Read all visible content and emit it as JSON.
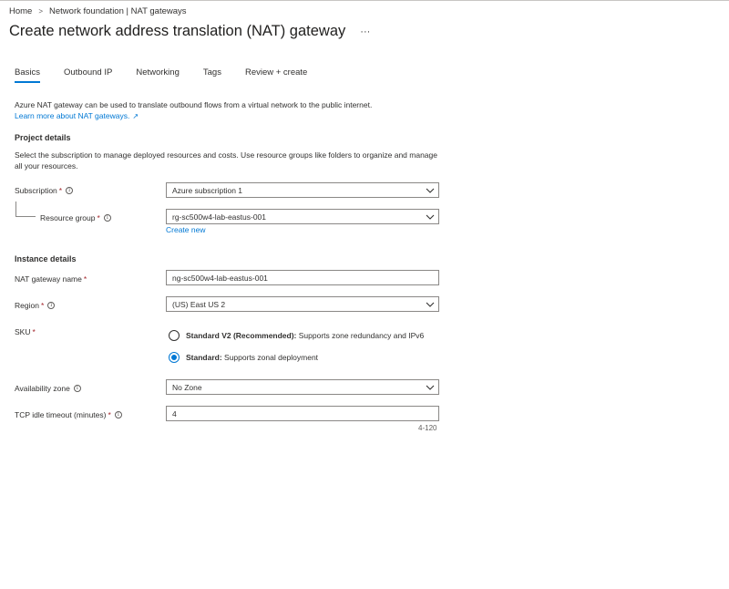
{
  "breadcrumb": {
    "items": [
      "Home",
      "Network foundation | NAT gateways"
    ],
    "separator": ">"
  },
  "header": {
    "title": "Create network address translation (NAT) gateway",
    "more_label": "···"
  },
  "tabs": [
    {
      "label": "Basics",
      "active": true
    },
    {
      "label": "Outbound IP",
      "active": false
    },
    {
      "label": "Networking",
      "active": false
    },
    {
      "label": "Tags",
      "active": false
    },
    {
      "label": "Review + create",
      "active": false
    }
  ],
  "intro": {
    "text": "Azure NAT gateway can be used to translate outbound flows from a virtual network to the public internet.",
    "link": "Learn more about NAT gateways."
  },
  "project_details": {
    "heading": "Project details",
    "description": "Select the subscription to manage deployed resources and costs. Use resource groups like folders to organize and manage all your resources.",
    "subscription": {
      "label": "Subscription",
      "required": "*",
      "value": "Azure subscription 1"
    },
    "resource_group": {
      "label": "Resource group",
      "required": "*",
      "value": "rg-sc500w4-lab-eastus-001",
      "create_new": "Create new"
    }
  },
  "instance_details": {
    "heading": "Instance details",
    "nat_name": {
      "label": "NAT gateway name",
      "required": "*",
      "value": "ng-sc500w4-lab-eastus-001"
    },
    "region": {
      "label": "Region",
      "required": "*",
      "value": "(US) East US 2"
    },
    "sku": {
      "label": "SKU",
      "required": "*",
      "options": [
        {
          "title": "Standard V2 (Recommended):",
          "desc": " Supports zone redundancy and IPv6",
          "checked": false
        },
        {
          "title": "Standard:",
          "desc": " Supports zonal deployment",
          "checked": true
        }
      ]
    },
    "availability_zone": {
      "label": "Availability zone",
      "value": "No Zone"
    },
    "tcp_timeout": {
      "label": "TCP idle timeout (minutes)",
      "required": "*",
      "value": "4",
      "range_hint": "4-120"
    }
  },
  "icons": {
    "info": "info-icon",
    "chevron": "chevron-down-icon",
    "external": "external-link-icon"
  },
  "colors": {
    "accent": "#0078d4",
    "required": "#a4262c",
    "border": "#8a8886"
  }
}
